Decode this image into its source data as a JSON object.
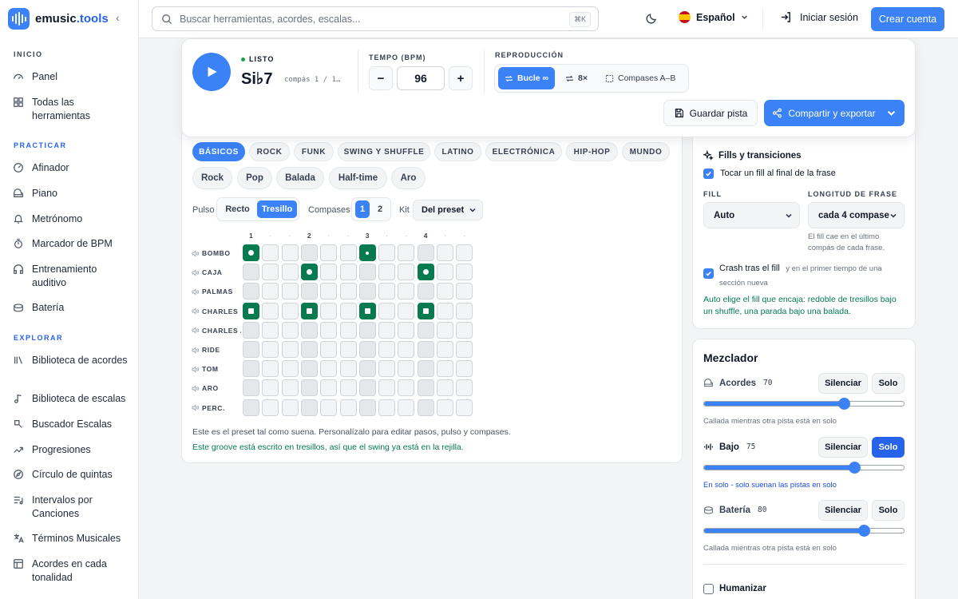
{
  "brand": {
    "name": "emusic",
    "tld": ".tools"
  },
  "search": {
    "placeholder": "Buscar herramientas, acordes, escalas...",
    "shortcut": "⌘K"
  },
  "header": {
    "language": "Español",
    "login": "Iniciar sesión",
    "signup": "Crear cuenta"
  },
  "sidebar": {
    "sections": [
      {
        "title": "INICIO",
        "items": [
          {
            "label": "Panel",
            "icon": "gauge-icon"
          },
          {
            "label": "Todas las herramientas",
            "icon": "grid-icon"
          }
        ]
      },
      {
        "title": "PRACTICAR",
        "items": [
          {
            "label": "Afinador",
            "icon": "tuner-icon"
          },
          {
            "label": "Piano",
            "icon": "piano-icon"
          },
          {
            "label": "Metrónomo",
            "icon": "bell-icon"
          },
          {
            "label": "Marcador de BPM",
            "icon": "timer-icon"
          },
          {
            "label": "Entrenamiento auditivo",
            "icon": "headphones-icon"
          },
          {
            "label": "Batería",
            "icon": "drum-icon"
          }
        ]
      },
      {
        "title": "EXPLORAR",
        "items": [
          {
            "label": "Biblioteca de acordes",
            "icon": "library-icon"
          },
          {
            "label": "Biblioteca de escalas",
            "icon": "music-note-icon"
          },
          {
            "label": "Buscador Escalas",
            "icon": "search-scale-icon"
          },
          {
            "label": "Progresiones",
            "icon": "trend-icon"
          },
          {
            "label": "Círculo de quintas",
            "icon": "compass-icon"
          },
          {
            "label": "Intervalos por Canciones",
            "icon": "playlist-icon"
          },
          {
            "label": "Términos Musicales",
            "icon": "translate-icon"
          },
          {
            "label": "Acordes en cada tonalidad",
            "icon": "table-icon"
          }
        ]
      }
    ]
  },
  "transport": {
    "status": "LISTO",
    "chord": "Si♭7",
    "measure": "compás 1 / 1…",
    "tempo_label": "TEMPO (BPM)",
    "tempo": "96",
    "minus": "−",
    "plus": "+",
    "playback_label": "REPRODUCCIÓN",
    "loop": "Bucle ∞",
    "repeat": "8×",
    "ab": "Compases A–B",
    "save": "Guardar pista",
    "share": "Compartir y exportar"
  },
  "categories": [
    "BÁSICOS",
    "ROCK",
    "FUNK",
    "SWING Y SHUFFLE",
    "LATINO",
    "ELECTRÓNICA",
    "HIP-HOP",
    "MUNDO"
  ],
  "presets": [
    "Rock",
    "Pop",
    "Balada",
    "Half-time",
    "Aro"
  ],
  "controls": {
    "pulse_label": "Pulso",
    "straight": "Recto",
    "triplet": "Tresillo",
    "bars_label": "Compases",
    "bar1": "1",
    "bar2": "2",
    "kit_label": "Kit",
    "kit": "Del preset"
  },
  "grid": {
    "beats": [
      "1",
      "2",
      "3",
      "4"
    ],
    "steps": 12,
    "rows": [
      {
        "label": "BOMBO",
        "on": [
          0,
          6
        ],
        "small": [
          6
        ]
      },
      {
        "label": "CAJA",
        "on": [
          3,
          9
        ],
        "small": []
      },
      {
        "label": "PALMAS",
        "on": [],
        "small": []
      },
      {
        "label": "CHARLES",
        "on": [
          0,
          3,
          6,
          9
        ],
        "small": [],
        "square": true
      },
      {
        "label": "CHARLES ABIERTO",
        "on": [],
        "small": []
      },
      {
        "label": "RIDE",
        "on": [],
        "small": []
      },
      {
        "label": "TOM",
        "on": [],
        "small": []
      },
      {
        "label": "ARO",
        "on": [],
        "small": []
      },
      {
        "label": "PERC.",
        "on": [],
        "small": []
      }
    ],
    "note1": "Este es el preset tal como suena. Personalízalo para editar pasos, pulso y compases.",
    "note2": "Este groove está escrito en tresillos, así que el swing ya está en la rejilla."
  },
  "fills": {
    "title": "Fills y transiciones",
    "fill_at_end": "Tocar un fill al final de la frase",
    "fill_label": "FILL",
    "fill_value": "Auto",
    "length_label": "LONGITUD DE FRASE",
    "length_value": "cada 4 compase",
    "length_help": "El fill cae en el último compás de cada frase.",
    "crash_main": "Crash tras el fill",
    "crash_rest": "y en el primer tiempo de una sección nueva",
    "auto_note": "Auto elige el fill que encaja: redoble de tresillos bajo un shuffle, una parada bajo una balada."
  },
  "mixer": {
    "title": "Mezclador",
    "mute": "Silenciar",
    "solo": "Solo",
    "tracks": [
      {
        "name": "Acordes",
        "value": "70",
        "level": 0.7,
        "solo": false,
        "note": "Callada mientras otra pista está en solo",
        "icon": "piano-icon"
      },
      {
        "name": "Bajo",
        "value": "75",
        "level": 0.75,
        "solo": true,
        "note": "En solo - solo suenan las pistas en solo",
        "icon": "waveform-icon"
      },
      {
        "name": "Batería",
        "value": "80",
        "level": 0.8,
        "solo": false,
        "note": "Callada mientras otra pista está en solo",
        "icon": "drum-icon"
      }
    ],
    "humanize": "Humanizar"
  },
  "colors": {
    "accent": "#3b82f6",
    "step_on": "#087a4f",
    "success": "#047857"
  }
}
